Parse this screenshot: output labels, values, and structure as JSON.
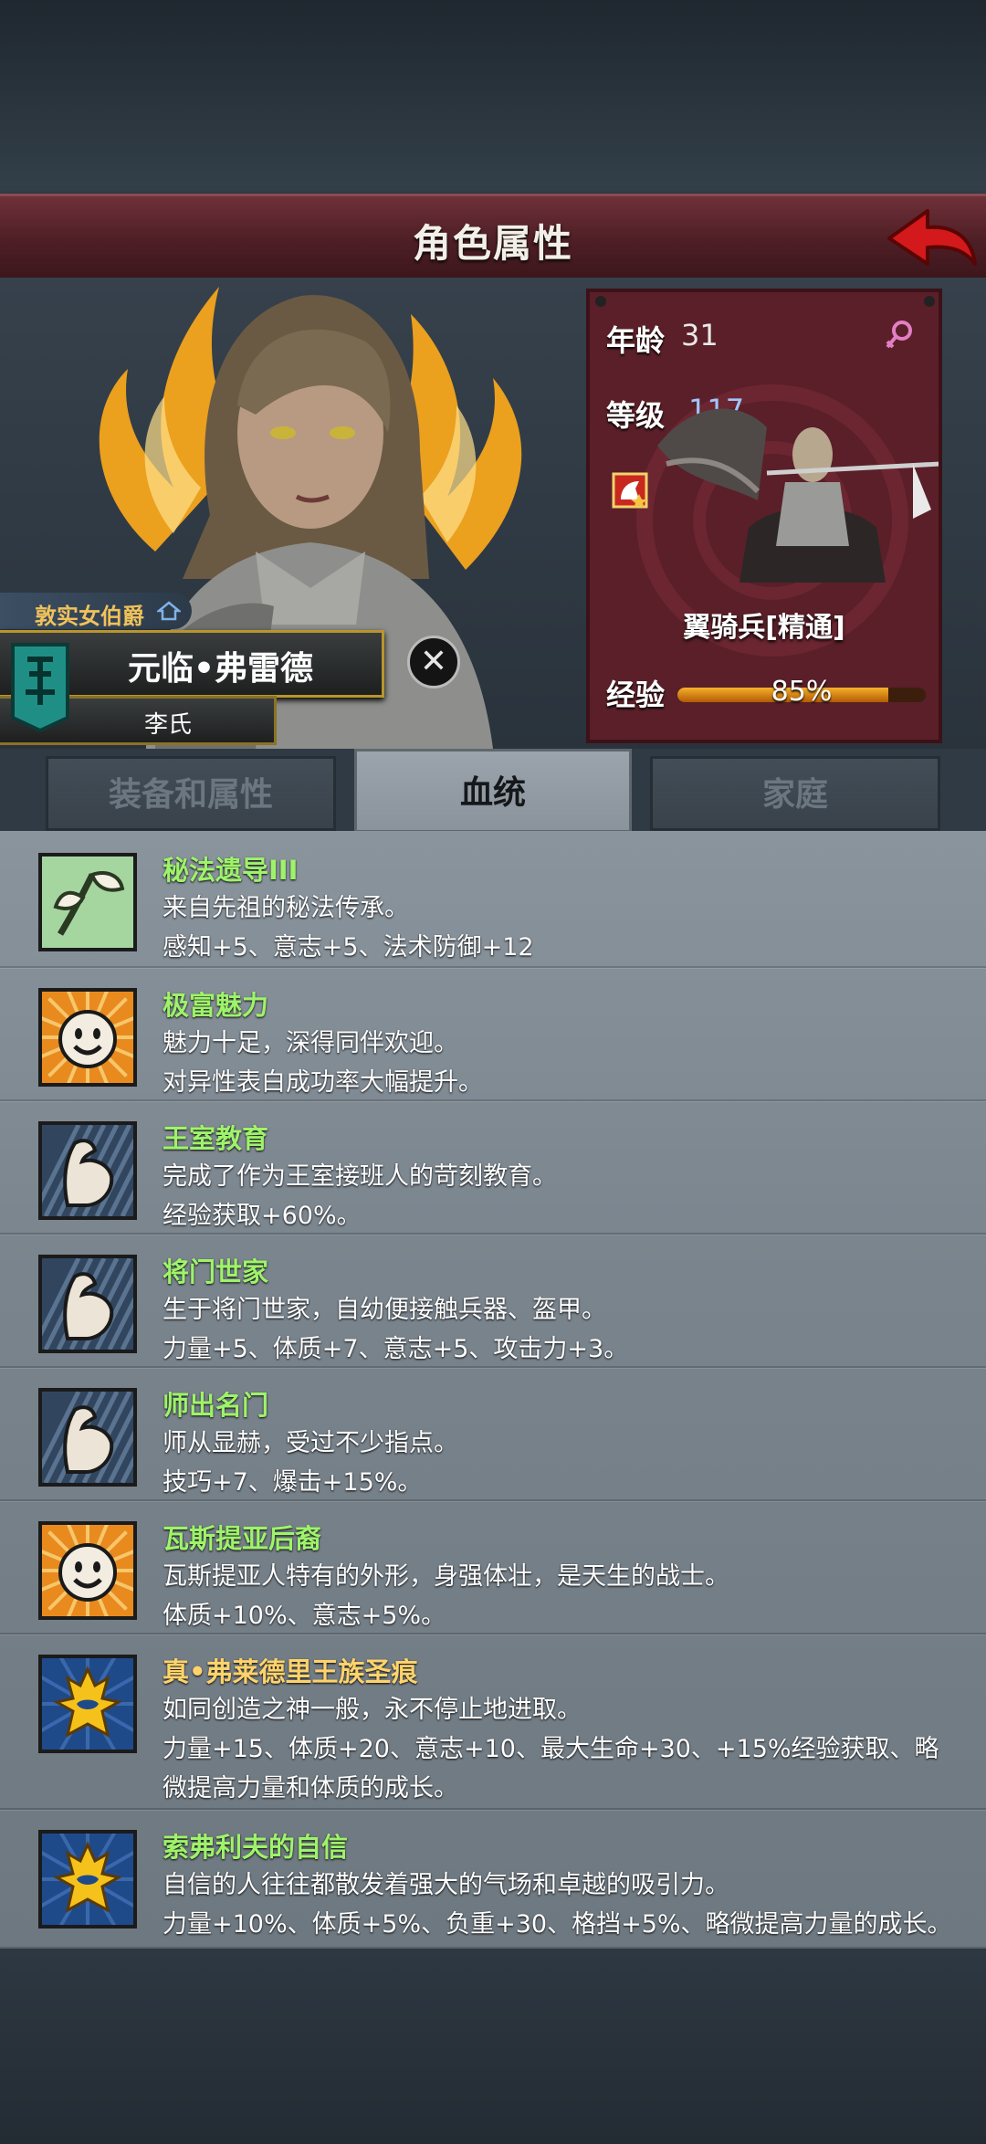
{
  "header": {
    "title": "角色属性"
  },
  "character": {
    "rank": "敦实女伯爵",
    "name": "元临•弗雷德",
    "surname": "李氏"
  },
  "stats": {
    "age_label": "年龄",
    "age_value": "31",
    "level_label": "等级",
    "level_value": "117",
    "unit_name": "翼骑兵[精通]",
    "exp_label": "经验",
    "exp_text": "85%",
    "exp_fraction": 0.85
  },
  "tabs": [
    {
      "label": "装备和属性",
      "active": false
    },
    {
      "label": "血统",
      "active": true
    },
    {
      "label": "家庭",
      "active": false
    }
  ],
  "traits": [
    {
      "name": "秘法遗导III",
      "color": "green",
      "icon": "sprout-icon",
      "lines": [
        "来自先祖的秘法传承。",
        "感知+5、意志+5、法术防御+12"
      ]
    },
    {
      "name": "极富魅力",
      "color": "green",
      "icon": "smile-icon",
      "lines": [
        "魅力十足，深得同伴欢迎。",
        "对异性表白成功率大幅提升。"
      ]
    },
    {
      "name": "王室教育",
      "color": "green",
      "icon": "arm-icon",
      "lines": [
        "完成了作为王室接班人的苛刻教育。",
        "经验获取+60%。"
      ]
    },
    {
      "name": "将门世家",
      "color": "green",
      "icon": "arm-icon",
      "lines": [
        "生于将门世家，自幼便接触兵器、盔甲。",
        "力量+5、体质+7、意志+5、攻击力+3。"
      ]
    },
    {
      "name": "师出名门",
      "color": "green",
      "icon": "arm-icon",
      "lines": [
        "师从显赫，受过不少指点。",
        "技巧+7、爆击+15%。"
      ]
    },
    {
      "name": "瓦斯提亚后裔",
      "color": "green",
      "icon": "smile-icon",
      "lines": [
        "瓦斯提亚人特有的外形，身强体壮，是天生的战士。",
        "体质+10%、意志+5%。"
      ]
    },
    {
      "name": "真•弗莱德里王族圣痕",
      "color": "gold",
      "icon": "royal-sigil-icon",
      "lines": [
        "如同创造之神一般，永不停止地进取。",
        "力量+15、体质+20、意志+10、最大生命+30、+15%经验获取、略",
        "微提高力量和体质的成长。"
      ]
    },
    {
      "name": "索弗利夫的自信",
      "color": "green",
      "icon": "royal-sigil-icon",
      "lines": [
        "自信的人往往都散发着强大的气场和卓越的吸引力。",
        "力量+10%、体质+5%、负重+30、格挡+5%、略微提高力量的成长。"
      ]
    }
  ]
}
